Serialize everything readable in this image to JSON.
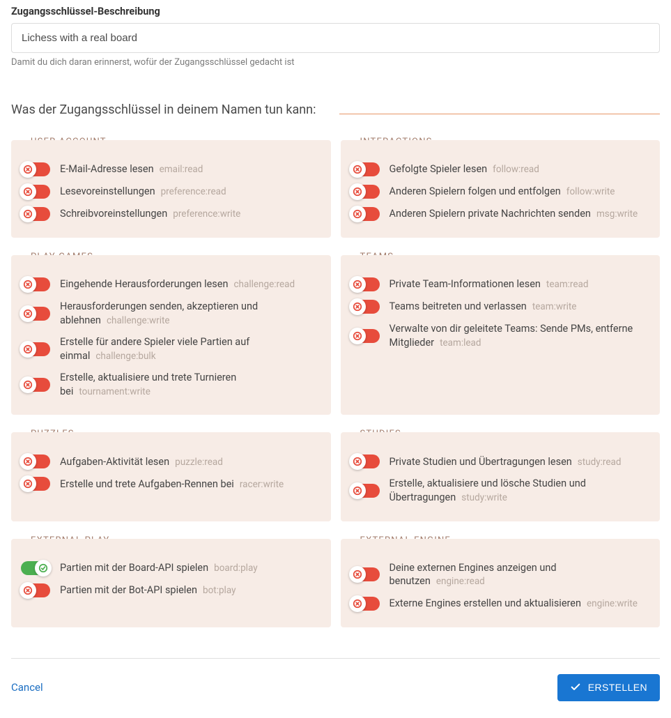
{
  "description": {
    "label": "Zugangsschlüssel-Beschreibung",
    "value": "Lichess with a real board",
    "help": "Damit du dich daran erinnerst, wofür der Zugangsschlüssel gedacht ist"
  },
  "permissions_heading": "Was der Zugangsschlüssel in deinem Namen tun kann:",
  "groups": [
    {
      "id": "user-account",
      "title": "USER ACCOUNT",
      "scopes": [
        {
          "label": "E-Mail-Adresse lesen",
          "code": "email:read",
          "on": false
        },
        {
          "label": "Lesevoreinstellungen",
          "code": "preference:read",
          "on": false
        },
        {
          "label": "Schreibvoreinstellungen",
          "code": "preference:write",
          "on": false
        }
      ]
    },
    {
      "id": "interactions",
      "title": "INTERACTIONS",
      "scopes": [
        {
          "label": "Gefolgte Spieler lesen",
          "code": "follow:read",
          "on": false
        },
        {
          "label": "Anderen Spielern folgen und entfolgen",
          "code": "follow:write",
          "on": false
        },
        {
          "label": "Anderen Spielern private Nachrichten senden",
          "code": "msg:write",
          "on": false
        }
      ]
    },
    {
      "id": "play-games",
      "title": "PLAY GAMES",
      "scopes": [
        {
          "label": "Eingehende Herausforderungen lesen",
          "code": "challenge:read",
          "on": false
        },
        {
          "label": "Herausforderungen senden, akzeptieren und ablehnen",
          "code": "challenge:write",
          "on": false
        },
        {
          "label": "Erstelle für andere Spieler viele Partien auf einmal",
          "code": "challenge:bulk",
          "on": false
        },
        {
          "label": "Erstelle, aktualisiere und trete Turnieren bei",
          "code": "tournament:write",
          "on": false
        }
      ]
    },
    {
      "id": "teams",
      "title": "TEAMS",
      "scopes": [
        {
          "label": "Private Team-Informationen lesen",
          "code": "team:read",
          "on": false
        },
        {
          "label": "Teams beitreten und verlassen",
          "code": "team:write",
          "on": false
        },
        {
          "label": "Verwalte von dir geleitete Teams: Sende PMs, entferne Mitglieder",
          "code": "team:lead",
          "on": false
        }
      ]
    },
    {
      "id": "puzzles",
      "title": "PUZZLES",
      "scopes": [
        {
          "label": "Aufgaben-Aktivität lesen",
          "code": "puzzle:read",
          "on": false
        },
        {
          "label": "Erstelle und trete Aufgaben-Rennen bei",
          "code": "racer:write",
          "on": false
        }
      ]
    },
    {
      "id": "studies",
      "title": "STUDIES",
      "scopes": [
        {
          "label": "Private Studien und Übertragungen lesen",
          "code": "study:read",
          "on": false
        },
        {
          "label": "Erstelle, aktualisiere und lösche Studien und Übertragungen",
          "code": "study:write",
          "on": false
        }
      ]
    },
    {
      "id": "external-play",
      "title": "EXTERNAL PLAY",
      "scopes": [
        {
          "label": "Partien mit der Board-API spielen",
          "code": "board:play",
          "on": true
        },
        {
          "label": "Partien mit der Bot-API spielen",
          "code": "bot:play",
          "on": false
        }
      ]
    },
    {
      "id": "external-engine",
      "title": "EXTERNAL ENGINE",
      "scopes": [
        {
          "label": "Deine externen Engines anzeigen und benutzen",
          "code": "engine:read",
          "on": false
        },
        {
          "label": "Externe Engines erstellen und aktualisieren",
          "code": "engine:write",
          "on": false
        }
      ]
    }
  ],
  "footer": {
    "cancel": "Cancel",
    "submit": "ERSTELLEN"
  }
}
